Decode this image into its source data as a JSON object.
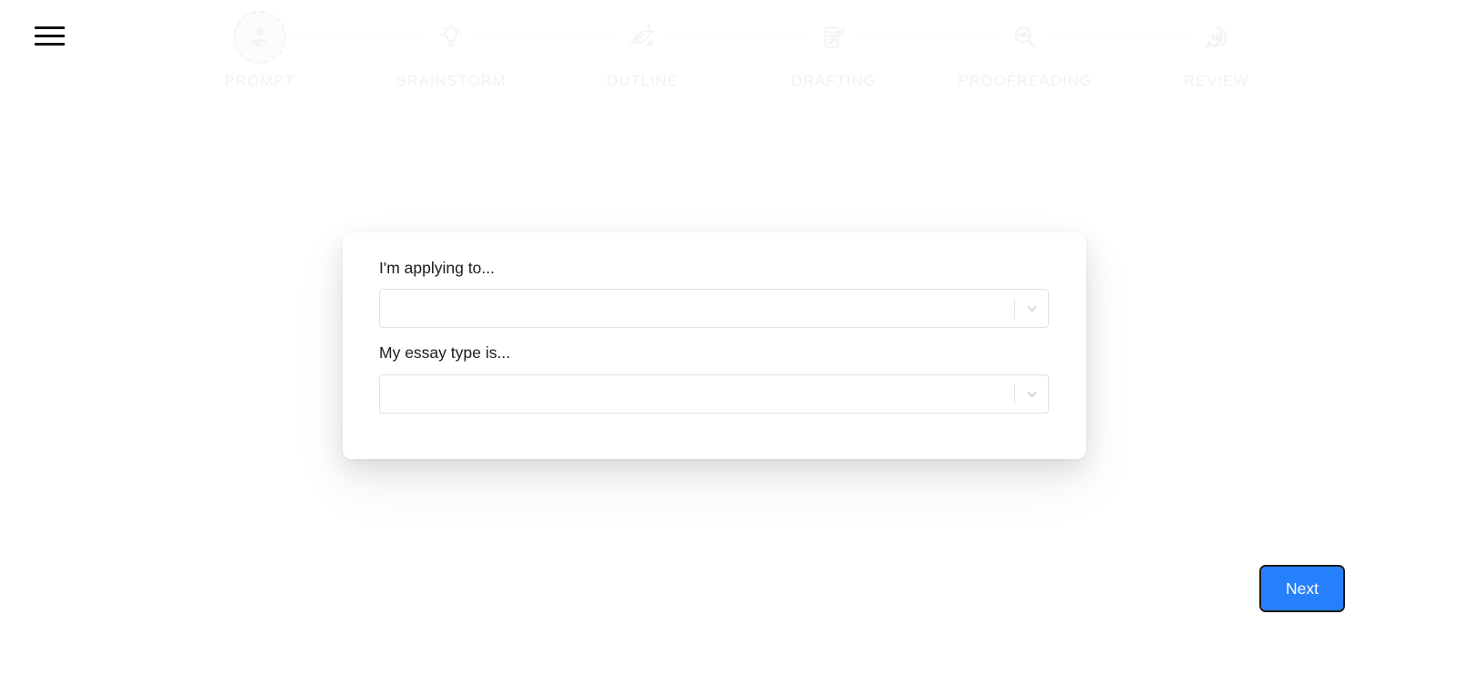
{
  "header": {
    "menu_button_label": "Menu"
  },
  "stepper": {
    "steps": [
      {
        "id": "prompt",
        "label": "PROMPT",
        "icon": "profile-photo-icon",
        "active": true
      },
      {
        "id": "brainstorm",
        "label": "BRAINSTORM",
        "icon": "lightbulb-icon",
        "active": false
      },
      {
        "id": "outline",
        "label": "OUTLINE",
        "icon": "outline-list-icon",
        "active": false
      },
      {
        "id": "drafting",
        "label": "DRAFTING",
        "icon": "document-pencil-icon",
        "active": false
      },
      {
        "id": "proofreading",
        "label": "PROOFREADING",
        "icon": "magnifier-eye-icon",
        "active": false
      },
      {
        "id": "review",
        "label": "REVIEW",
        "icon": "speech-thumbsup-icon",
        "active": false
      }
    ]
  },
  "card": {
    "fields": [
      {
        "id": "applying-to",
        "label": "I'm applying to...",
        "value": "",
        "placeholder": "",
        "arrow_icon": "chevron-down-icon"
      },
      {
        "id": "essay-type",
        "label": "My essay type is...",
        "value": "",
        "placeholder": "",
        "arrow_icon": "chevron-down-icon"
      }
    ]
  },
  "footer": {
    "next_label": "Next"
  },
  "colors": {
    "accent": "#2680fb",
    "step_label": "#f2f2f3",
    "text": "#1b1b1b",
    "border": "#e2e2e4",
    "background": "#ffffff",
    "focus_ring": "#1a1a1a"
  }
}
